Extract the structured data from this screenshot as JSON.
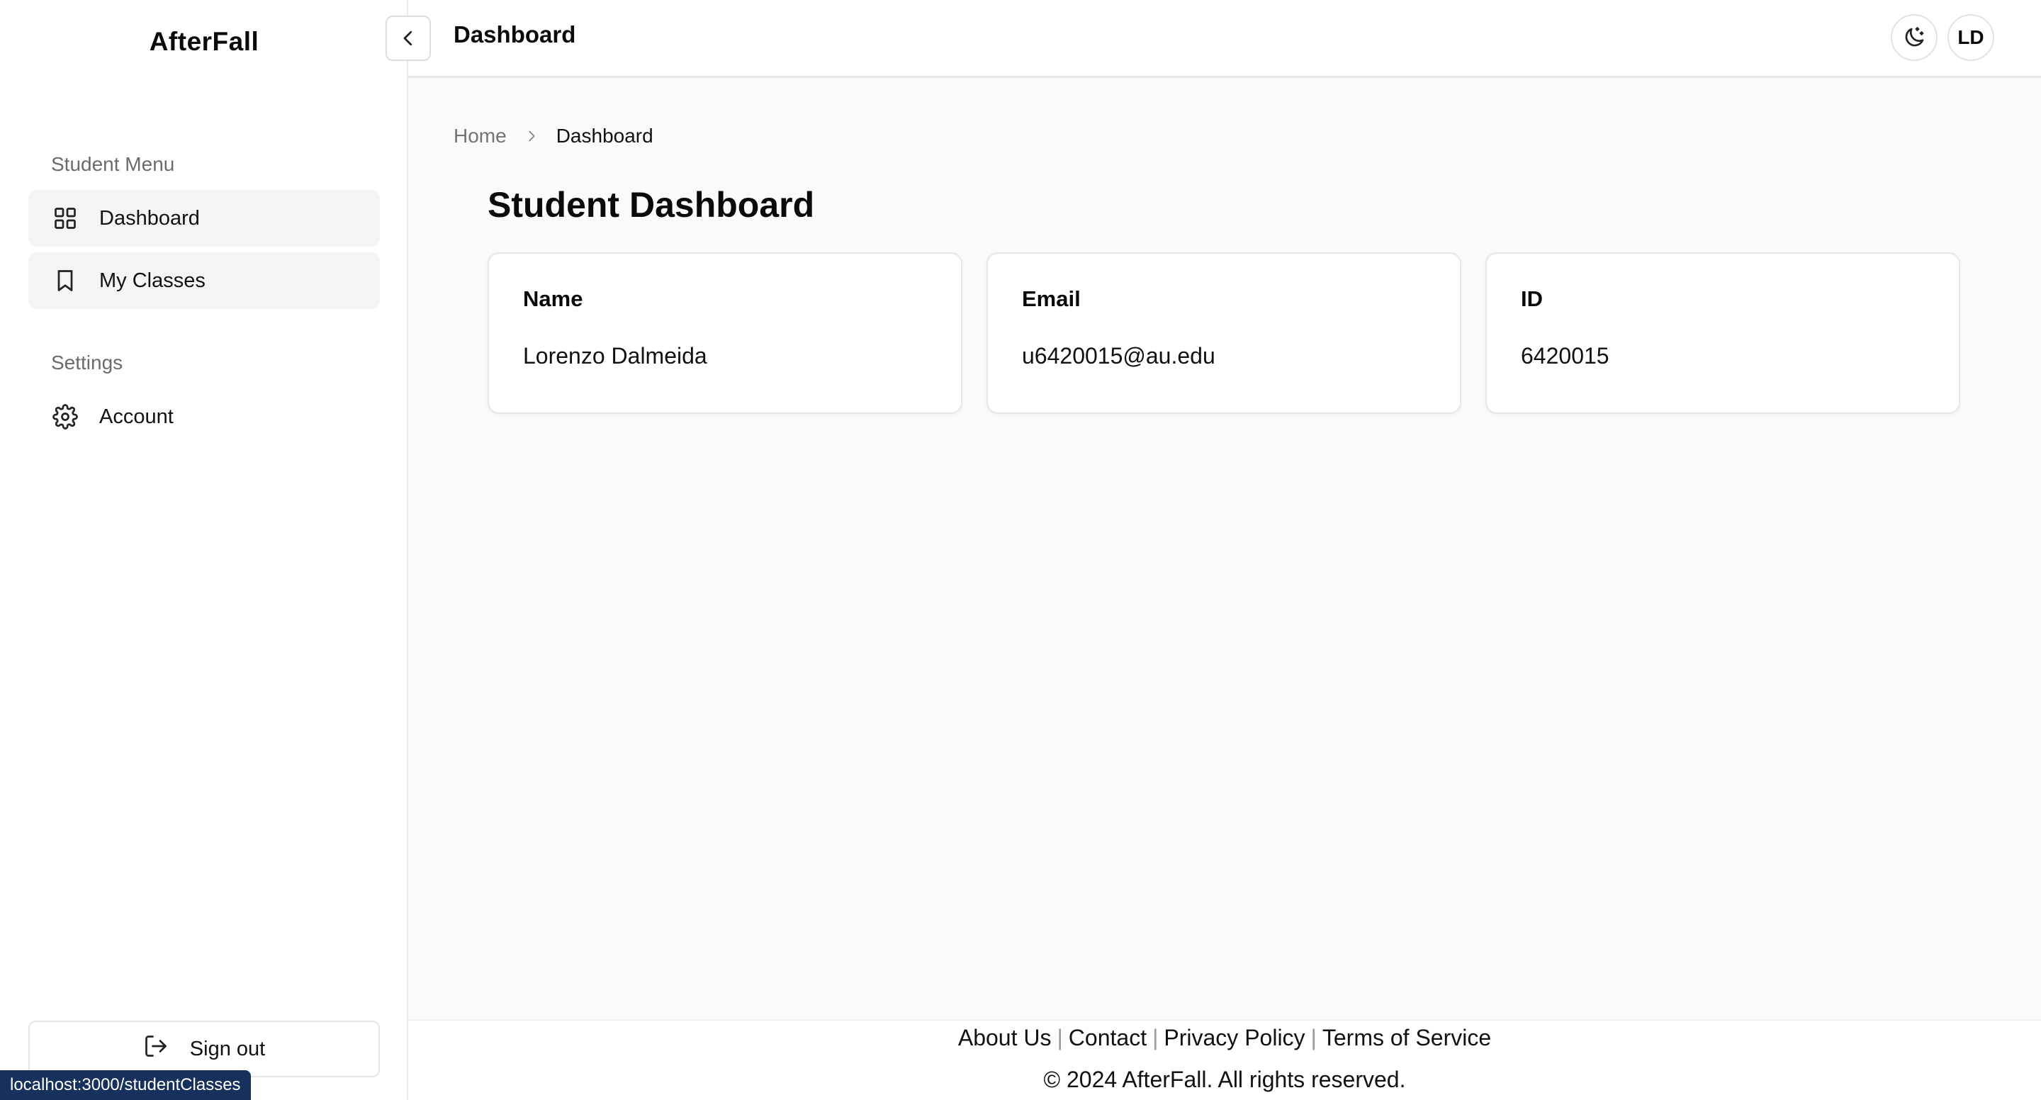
{
  "sidebar": {
    "brand": "AfterFall",
    "student_menu_label": "Student Menu",
    "items": [
      {
        "label": "Dashboard",
        "icon": "grid-icon"
      },
      {
        "label": "My Classes",
        "icon": "bookmark-icon"
      }
    ],
    "settings_label": "Settings",
    "settings_items": [
      {
        "label": "Account",
        "icon": "gear-icon"
      }
    ],
    "signout_label": "Sign out"
  },
  "status_bar": {
    "url": "localhost:3000/studentClasses"
  },
  "header": {
    "title": "Dashboard",
    "avatar_initials": "LD",
    "theme_icon": "moon-stars-icon"
  },
  "breadcrumb": {
    "home": "Home",
    "current": "Dashboard"
  },
  "main": {
    "page_title": "Student Dashboard",
    "cards": [
      {
        "label": "Name",
        "value": "Lorenzo Dalmeida"
      },
      {
        "label": "Email",
        "value": "u6420015@au.edu"
      },
      {
        "label": "ID",
        "value": "6420015"
      }
    ]
  },
  "footer": {
    "links": [
      "About Us",
      "Contact",
      "Privacy Policy",
      "Terms of Service"
    ],
    "separator": "|",
    "copyright": "© 2024 AfterFall. All rights reserved."
  }
}
